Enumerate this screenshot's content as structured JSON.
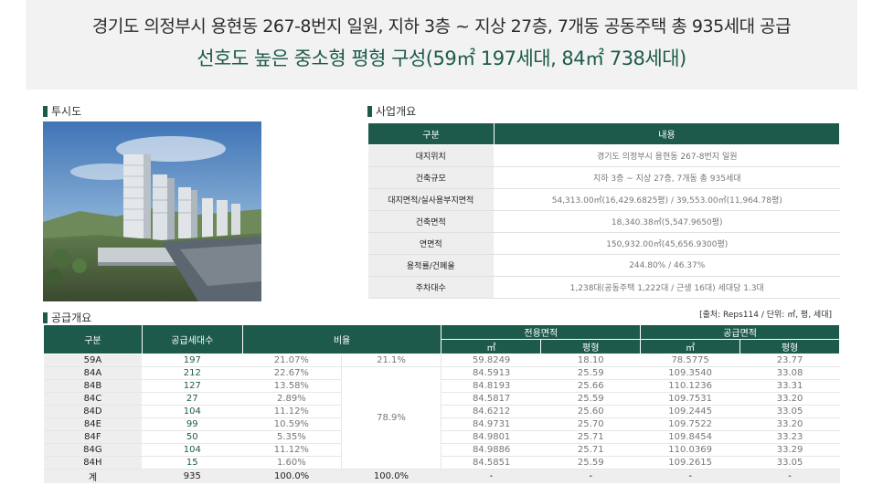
{
  "header": {
    "line1": "경기도 의정부시 용현동 267-8번지 일원, 지하 3층 ~ 지상 27층, 7개동 공동주택 총 935세대 공급",
    "line2": "선호도 높은 중소형 평형 구성(59㎡ 197세대, 84㎡ 738세대)"
  },
  "perspective": {
    "title": "투시도"
  },
  "business": {
    "title": "사업개요",
    "col_label": "구분",
    "col_value": "내용",
    "rows": [
      {
        "label": "대지위치",
        "value": "경기도 의정부시 용현동 267-8번지 일원"
      },
      {
        "label": "건축규모",
        "value": "지하 3층 ~ 지상 27층, 7개동 총 935세대"
      },
      {
        "label": "대지면적/실사용부지면적",
        "value": "54,313.00㎡(16,429.6825평) / 39,553.00㎡(11,964.78평)"
      },
      {
        "label": "건축면적",
        "value": "18,340.38㎡(5,547.9650평)"
      },
      {
        "label": "연면적",
        "value": "150,932.00㎡(45,656.9300평)"
      },
      {
        "label": "용적률/건폐율",
        "value": "244.80% / 46.37%"
      },
      {
        "label": "주차대수",
        "value": "1,238대(공동주택 1,222대 / 근생 16대) 세대당 1.3대"
      }
    ]
  },
  "supply": {
    "title": "공급개요",
    "source": "[출처: Reps114 / 단위: ㎡, 평, 세대]",
    "headers": {
      "type": "구분",
      "count": "공급세대수",
      "ratio": "비율",
      "exclusive": "전용면적",
      "supply_area": "공급면적",
      "m2": "㎡",
      "pyeong": "평형"
    },
    "rows": [
      {
        "type": "59A",
        "count": "197",
        "ratio": "21.07%",
        "exc_m2": "59.8249",
        "exc_py": "18.10",
        "sup_m2": "78.5775",
        "sup_py": "23.77"
      },
      {
        "type": "84A",
        "count": "212",
        "ratio": "22.67%",
        "exc_m2": "84.5913",
        "exc_py": "25.59",
        "sup_m2": "109.3540",
        "sup_py": "33.08"
      },
      {
        "type": "84B",
        "count": "127",
        "ratio": "13.58%",
        "exc_m2": "84.8193",
        "exc_py": "25.66",
        "sup_m2": "110.1236",
        "sup_py": "33.31"
      },
      {
        "type": "84C",
        "count": "27",
        "ratio": "2.89%",
        "exc_m2": "84.5817",
        "exc_py": "25.59",
        "sup_m2": "109.7531",
        "sup_py": "33.20"
      },
      {
        "type": "84D",
        "count": "104",
        "ratio": "11.12%",
        "exc_m2": "84.6212",
        "exc_py": "25.60",
        "sup_m2": "109.2445",
        "sup_py": "33.05"
      },
      {
        "type": "84E",
        "count": "99",
        "ratio": "10.59%",
        "exc_m2": "84.9731",
        "exc_py": "25.70",
        "sup_m2": "109.7522",
        "sup_py": "33.20"
      },
      {
        "type": "84F",
        "count": "50",
        "ratio": "5.35%",
        "exc_m2": "84.9801",
        "exc_py": "25.71",
        "sup_m2": "109.8454",
        "sup_py": "33.23"
      },
      {
        "type": "84G",
        "count": "104",
        "ratio": "11.12%",
        "exc_m2": "84.9886",
        "exc_py": "25.71",
        "sup_m2": "110.0369",
        "sup_py": "33.29"
      },
      {
        "type": "84H",
        "count": "15",
        "ratio": "1.60%",
        "exc_m2": "84.5851",
        "exc_py": "25.59",
        "sup_m2": "109.2615",
        "sup_py": "33.05"
      }
    ],
    "group_ratio_59": "21.1%",
    "group_ratio_84": "78.9%",
    "total": {
      "type": "계",
      "count": "935",
      "ratio": "100.0%",
      "group": "100.0%",
      "exc_m2": "-",
      "exc_py": "-",
      "sup_m2": "-",
      "sup_py": "-"
    }
  }
}
